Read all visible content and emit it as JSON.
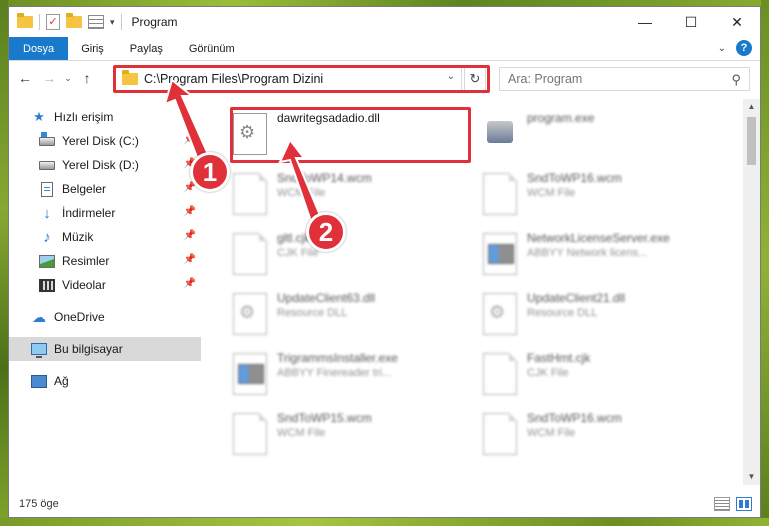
{
  "window": {
    "title": "Program",
    "controls": {
      "minimize": "—",
      "maximize": "☐",
      "close": "✕"
    }
  },
  "ribbon": {
    "tabs": [
      "Dosya",
      "Giriş",
      "Paylaş",
      "Görünüm"
    ],
    "active_tab": "Dosya",
    "collapse_icon": "chevron-down-icon",
    "help_label": "?"
  },
  "navigation": {
    "address_path": "C:\\Program Files\\Program Dizini",
    "search_placeholder": "Ara: Program"
  },
  "sidebar": {
    "items": [
      {
        "label": "Hızlı erişim",
        "icon": "star-icon",
        "pinned": false
      },
      {
        "label": "Yerel Disk (C:)",
        "icon": "drive-icon",
        "pinned": true
      },
      {
        "label": "Yerel Disk (D:)",
        "icon": "drive-icon",
        "pinned": true
      },
      {
        "label": "Belgeler",
        "icon": "document-icon",
        "pinned": true
      },
      {
        "label": "İndirmeler",
        "icon": "download-icon",
        "pinned": true
      },
      {
        "label": "Müzik",
        "icon": "music-icon",
        "pinned": true
      },
      {
        "label": "Resimler",
        "icon": "pictures-icon",
        "pinned": true
      },
      {
        "label": "Videolar",
        "icon": "video-icon",
        "pinned": true
      },
      {
        "label": "OneDrive",
        "icon": "cloud-icon",
        "pinned": false
      },
      {
        "label": "Bu bilgisayar",
        "icon": "computer-icon",
        "pinned": false,
        "selected": true
      },
      {
        "label": "Ağ",
        "icon": "network-icon",
        "pinned": false
      }
    ]
  },
  "files": [
    {
      "name": "dawritegsadadio.dll",
      "type": "",
      "icon": "gear-file-icon"
    },
    {
      "name": "program.exe",
      "type": "",
      "icon": "exe-file-icon"
    },
    {
      "name": "SndToWP14.wcm",
      "type": "WCM File",
      "icon": "file-icon"
    },
    {
      "name": "SndToWP16.wcm",
      "type": "WCM File",
      "icon": "file-icon"
    },
    {
      "name": "gltl.cjk",
      "type": "CJK File",
      "icon": "file-icon"
    },
    {
      "name": "NetworkLicenseServer.exe",
      "type": "ABBYY Network licens...",
      "icon": "app-file-icon"
    },
    {
      "name": "UpdateClient63.dll",
      "type": "Resource DLL",
      "icon": "gear-file-icon"
    },
    {
      "name": "UpdateClient21.dll",
      "type": "Resource DLL",
      "icon": "gear-file-icon"
    },
    {
      "name": "TrigrammsInstaller.exe",
      "type": "ABBYY Finereader tri...",
      "icon": "app-file-icon"
    },
    {
      "name": "FastHmt.cjk",
      "type": "CJK File",
      "icon": "file-icon"
    },
    {
      "name": "SndToWP15.wcm",
      "type": "WCM File",
      "icon": "file-icon"
    },
    {
      "name": "SndToWP16.wcm",
      "type": "WCM File",
      "icon": "file-icon"
    }
  ],
  "status": {
    "item_count": "175 öge"
  },
  "annotations": {
    "marker_1": "1",
    "marker_2": "2",
    "color": "#e0303a"
  },
  "colors": {
    "accent": "#1979ca",
    "highlight": "#e0303a"
  }
}
